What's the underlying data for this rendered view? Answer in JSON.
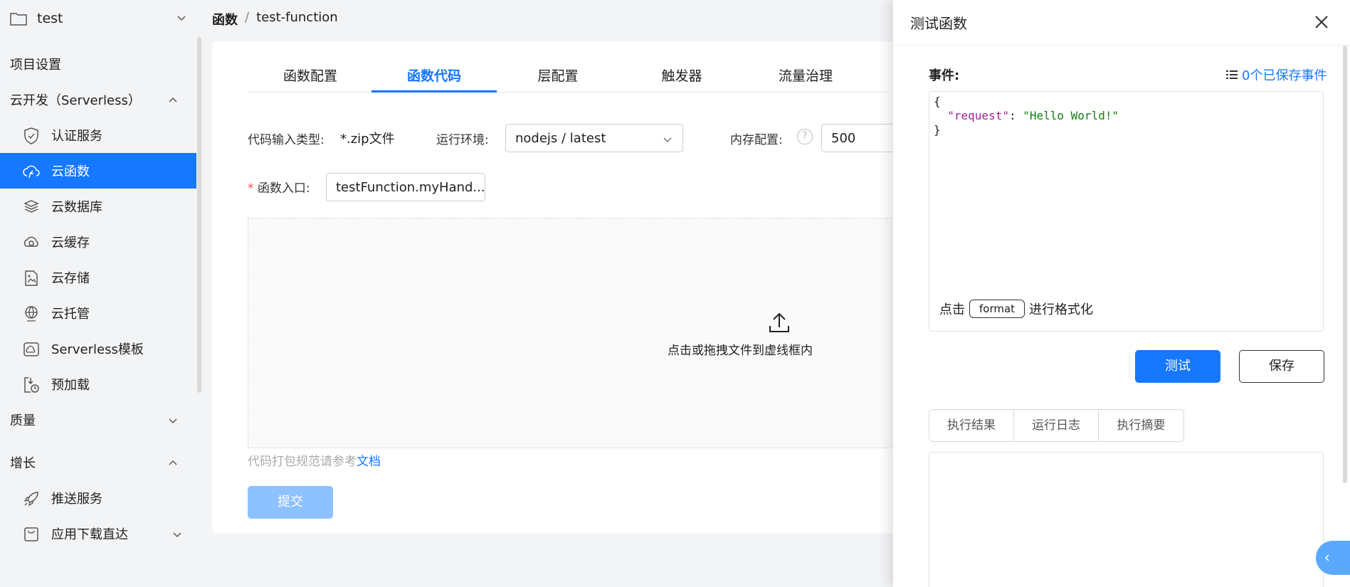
{
  "sidebar": {
    "project": "test",
    "items": [
      {
        "label": "项目设置"
      },
      {
        "label": "云开发（Serverless）"
      },
      {
        "label": "认证服务",
        "icon": "shield-icon"
      },
      {
        "label": "云函数",
        "icon": "cloud-function-icon"
      },
      {
        "label": "云数据库",
        "icon": "database-icon"
      },
      {
        "label": "云缓存",
        "icon": "cache-icon"
      },
      {
        "label": "云存储",
        "icon": "storage-icon"
      },
      {
        "label": "云托管",
        "icon": "globe-icon"
      },
      {
        "label": "Serverless模板",
        "icon": "template-icon"
      },
      {
        "label": "预加载",
        "icon": "preload-icon"
      },
      {
        "label": "质量"
      },
      {
        "label": "增长"
      },
      {
        "label": "推送服务",
        "icon": "rocket-icon"
      },
      {
        "label": "应用下载直达",
        "icon": "download-box-icon"
      }
    ]
  },
  "breadcrumb": {
    "parent": "函数",
    "sep": "/",
    "current": "test-function"
  },
  "tabs": [
    "函数配置",
    "函数代码",
    "层配置",
    "触发器",
    "流量治理"
  ],
  "form": {
    "code_type_label": "代码输入类型:",
    "code_type_value": "*.zip文件",
    "runtime_label": "运行环境:",
    "runtime_value": "nodejs / latest",
    "memory_label": "内存配置:",
    "memory_value": "500",
    "help_glyph": "?",
    "required_mark": "*",
    "entry_label": "函数入口:",
    "entry_value": "testFunction.myHand..."
  },
  "upload": {
    "text": "点击或拖拽文件到虚线框内"
  },
  "hint": {
    "text": "代码打包规范请参考",
    "link": "文档"
  },
  "submit_label": "提交",
  "drawer": {
    "title": "测试函数",
    "event_label": "事件:",
    "saved_events": "0个已保存事件",
    "code": {
      "open": "{",
      "key": "\"request\"",
      "colon": ": ",
      "value": "\"Hello World!\"",
      "close": "}"
    },
    "format_prefix": "点击",
    "format_button": "format",
    "format_suffix": "进行格式化",
    "test_label": "测试",
    "save_label": "保存",
    "result_tabs": [
      "执行结果",
      "运行日志",
      "执行摘要"
    ]
  },
  "colors": {
    "accent": "#1677ff",
    "accent_disabled": "#8ec1ff"
  }
}
